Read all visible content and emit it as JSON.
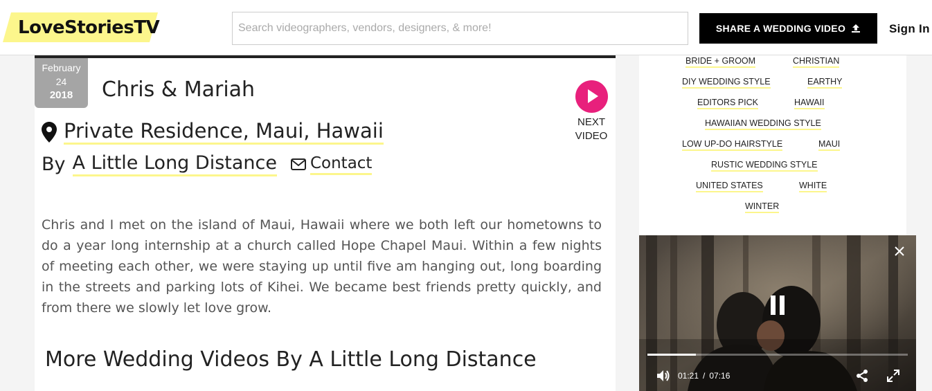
{
  "header": {
    "logo": "LoveStoriesTV",
    "search_placeholder": "Search videographers, vendors, designers, & more!",
    "share_button": "SHARE A WEDDING VIDEO",
    "sign_in": "Sign In"
  },
  "video": {
    "date": {
      "month": "February",
      "day": "24",
      "year": "2018"
    },
    "title": "Chris & Mariah",
    "location": "Private Residence, Maui, Hawaii",
    "by_label": "By",
    "author": "A Little Long Distance",
    "contact": "Contact",
    "next_video": {
      "line1": "NEXT",
      "line2": "VIDEO"
    },
    "description": "Chris and I met on the island of Maui, Hawaii where we both left our hometowns to do a year long internship at a church called Hope Chapel Maui. Within a few nights of meeting each other, we were staying up until five am hanging out, long boarding in the streets and parking lots of Kihei. We became best friends pretty quickly, and from there we slowly let love grow.",
    "more_title": "More Wedding Videos By A Little Long Distance"
  },
  "tags": [
    "BRIDE + GROOM",
    "CHRISTIAN",
    "DIY WEDDING STYLE",
    "EARTHY",
    "EDITORS PICK",
    "HAWAII",
    "HAWAIIAN WEDDING STYLE",
    "LOW UP-DO HAIRSTYLE",
    "MAUI",
    "RUSTIC WEDDING STYLE",
    "UNITED STATES",
    "WHITE",
    "WINTER"
  ],
  "player": {
    "current_time": "01:21",
    "separator": "/",
    "duration": "07:16",
    "progress_fraction": 0.186
  },
  "colors": {
    "logo_yellow": "#fcf68c",
    "accent_pink": "#e8207c",
    "date_badge_gray": "#a5a5a5"
  }
}
